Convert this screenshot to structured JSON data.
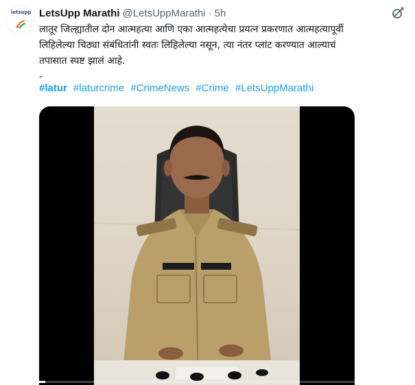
{
  "account": {
    "display_name": "LetsUpp Marathi",
    "handle": "@LetsUppMarathi",
    "separator": "·",
    "time": "5h",
    "avatar_brand": "letsupp"
  },
  "tweet": {
    "lines": [
      "लातूर जिल्ह्यातील दोन आत्महत्या आणि एका आत्महत्येचा प्रयत्न प्रकरणात आत्महत्यापूर्वी",
      "लिहिलेल्या चिठ्या संबंधितांनी स्वतः लिहिलेल्या नसून, त्या नंतर प्लांट करण्यात आल्याचं",
      "तपासात स्पष्ट झालं आहे.",
      "-"
    ],
    "hashtags": [
      "#latur",
      "#laturcrime",
      "#CrimeNews",
      "#Crime",
      "#LetsUppMarathi"
    ]
  },
  "media": {
    "type": "video",
    "progress": 0.02
  },
  "colors": {
    "link": "#1d9bf0",
    "secondary_text": "#536471",
    "brand_orange": "#f26b21"
  },
  "icons": {
    "more": "grok-icon",
    "avatar": "letsupp-logo-icon"
  }
}
